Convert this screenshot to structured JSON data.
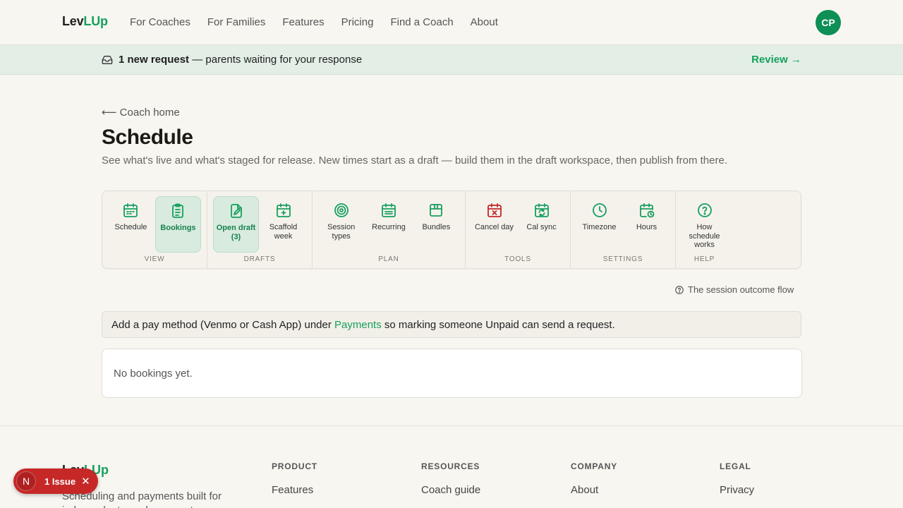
{
  "brand": {
    "part1": "Lev",
    "part2": "LUp"
  },
  "nav": {
    "items": [
      "For Coaches",
      "For Families",
      "Features",
      "Pricing",
      "Find a Coach",
      "About"
    ]
  },
  "avatar": {
    "initials": "CP"
  },
  "banner": {
    "bold": "1 new request",
    "rest": " — parents waiting for your response",
    "action": "Review →"
  },
  "page": {
    "back": "⟵ Coach home",
    "title": "Schedule",
    "subtitle": "See what's live and what's staged for release. New times start as a draft — build them in the draft workspace, then publish from there."
  },
  "toolbar": {
    "groups": [
      {
        "label": "VIEW",
        "items": [
          {
            "label": "Schedule",
            "icon": "calendar-icon"
          },
          {
            "label": "Bookings",
            "icon": "clipboard-icon",
            "active": true
          }
        ]
      },
      {
        "label": "DRAFTS",
        "items": [
          {
            "label": "Open draft (3)",
            "icon": "edit-document-icon",
            "active": true
          },
          {
            "label": "Scaffold week",
            "icon": "calendar-plus-icon"
          }
        ]
      },
      {
        "label": "PLAN",
        "items": [
          {
            "label": "Session types",
            "icon": "target-icon"
          },
          {
            "label": "Recurring",
            "icon": "calendar-grid-icon"
          },
          {
            "label": "Bundles",
            "icon": "package-icon"
          }
        ]
      },
      {
        "label": "TOOLS",
        "items": [
          {
            "label": "Cancel day",
            "icon": "calendar-x-icon"
          },
          {
            "label": "Cal sync",
            "icon": "calendar-sync-icon"
          }
        ]
      },
      {
        "label": "SETTINGS",
        "items": [
          {
            "label": "Timezone",
            "icon": "clock-icon"
          },
          {
            "label": "Hours",
            "icon": "calendar-clock-icon"
          }
        ]
      },
      {
        "label": "HELP",
        "items": [
          {
            "label": "How schedule works",
            "icon": "help-circle-icon"
          }
        ]
      }
    ]
  },
  "flow": {
    "label": "The session outcome flow"
  },
  "notice": {
    "before": "Add a pay method (Venmo or Cash App) under ",
    "link": "Payments",
    "after": " so marking someone Unpaid can send a request."
  },
  "bookings": {
    "empty": "No bookings yet."
  },
  "footer": {
    "description": "Scheduling and payments built for independent coaches — set your",
    "columns": [
      {
        "heading": "PRODUCT",
        "links": [
          "Features"
        ]
      },
      {
        "heading": "RESOURCES",
        "links": [
          "Coach guide"
        ]
      },
      {
        "heading": "COMPANY",
        "links": [
          "About"
        ]
      },
      {
        "heading": "LEGAL",
        "links": [
          "Privacy"
        ]
      }
    ]
  },
  "issue": {
    "avatar": "N",
    "label": "1 Issue",
    "close": "✕"
  },
  "colors": {
    "accent": "#16a05e",
    "danger": "#c62828",
    "background": "#f8f6f1"
  }
}
